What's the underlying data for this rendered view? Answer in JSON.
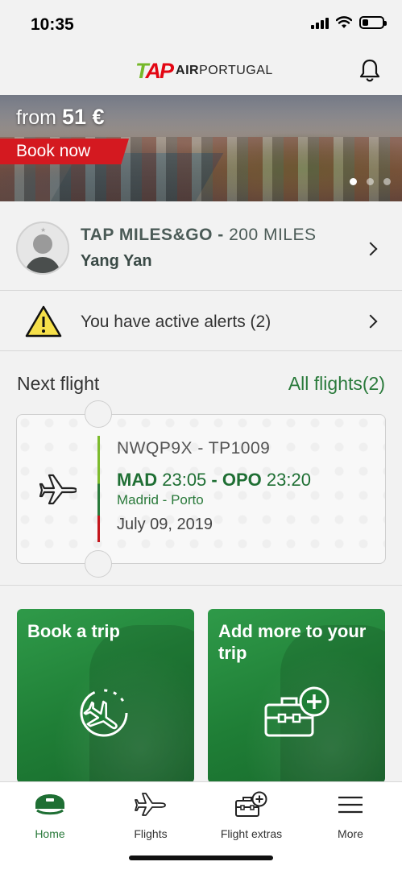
{
  "status_bar": {
    "time": "10:35",
    "battery_level": 0.3
  },
  "header": {
    "logo_mark": "TAP",
    "logo_text_bold": "AIR",
    "logo_text": "PORTUGAL",
    "notification_icon": "bell-icon"
  },
  "banner": {
    "from_label": "from",
    "price": "51 €",
    "cta": "Book now",
    "slides": 3,
    "active_slide": 1
  },
  "miles": {
    "program": "TAP MILES&GO",
    "separator": "-",
    "balance": "200 MILES",
    "member_name": "Yang Yan"
  },
  "alerts": {
    "text": "You have active alerts (2)",
    "icon": "warning-icon"
  },
  "next_flight": {
    "title": "Next flight",
    "all_flights": "All flights(2)",
    "booking_code": "NWQP9X - TP1009",
    "origin_code": "MAD",
    "departure_time": "23:05",
    "dash": "-",
    "destination_code": "OPO",
    "arrival_time": "23:20",
    "cities": "Madrid -  Porto",
    "date": "July 09, 2019"
  },
  "tiles": [
    {
      "title": "Book a trip",
      "icon": "globe-plane-icon"
    },
    {
      "title": "Add more to your trip",
      "icon": "luggage-plus-icon"
    }
  ],
  "tabs": [
    {
      "label": "Home",
      "icon": "pilot-cap-icon",
      "active": true
    },
    {
      "label": "Flights",
      "icon": "plane-icon",
      "active": false
    },
    {
      "label": "Flight extras",
      "icon": "luggage-plus-icon",
      "active": false
    },
    {
      "label": "More",
      "icon": "menu-icon",
      "active": false
    }
  ],
  "colors": {
    "brand_green": "#2a7a3b",
    "brand_red": "#d41920",
    "tile_green": "#1f7e36",
    "alert_yellow": "#f6e04a"
  }
}
